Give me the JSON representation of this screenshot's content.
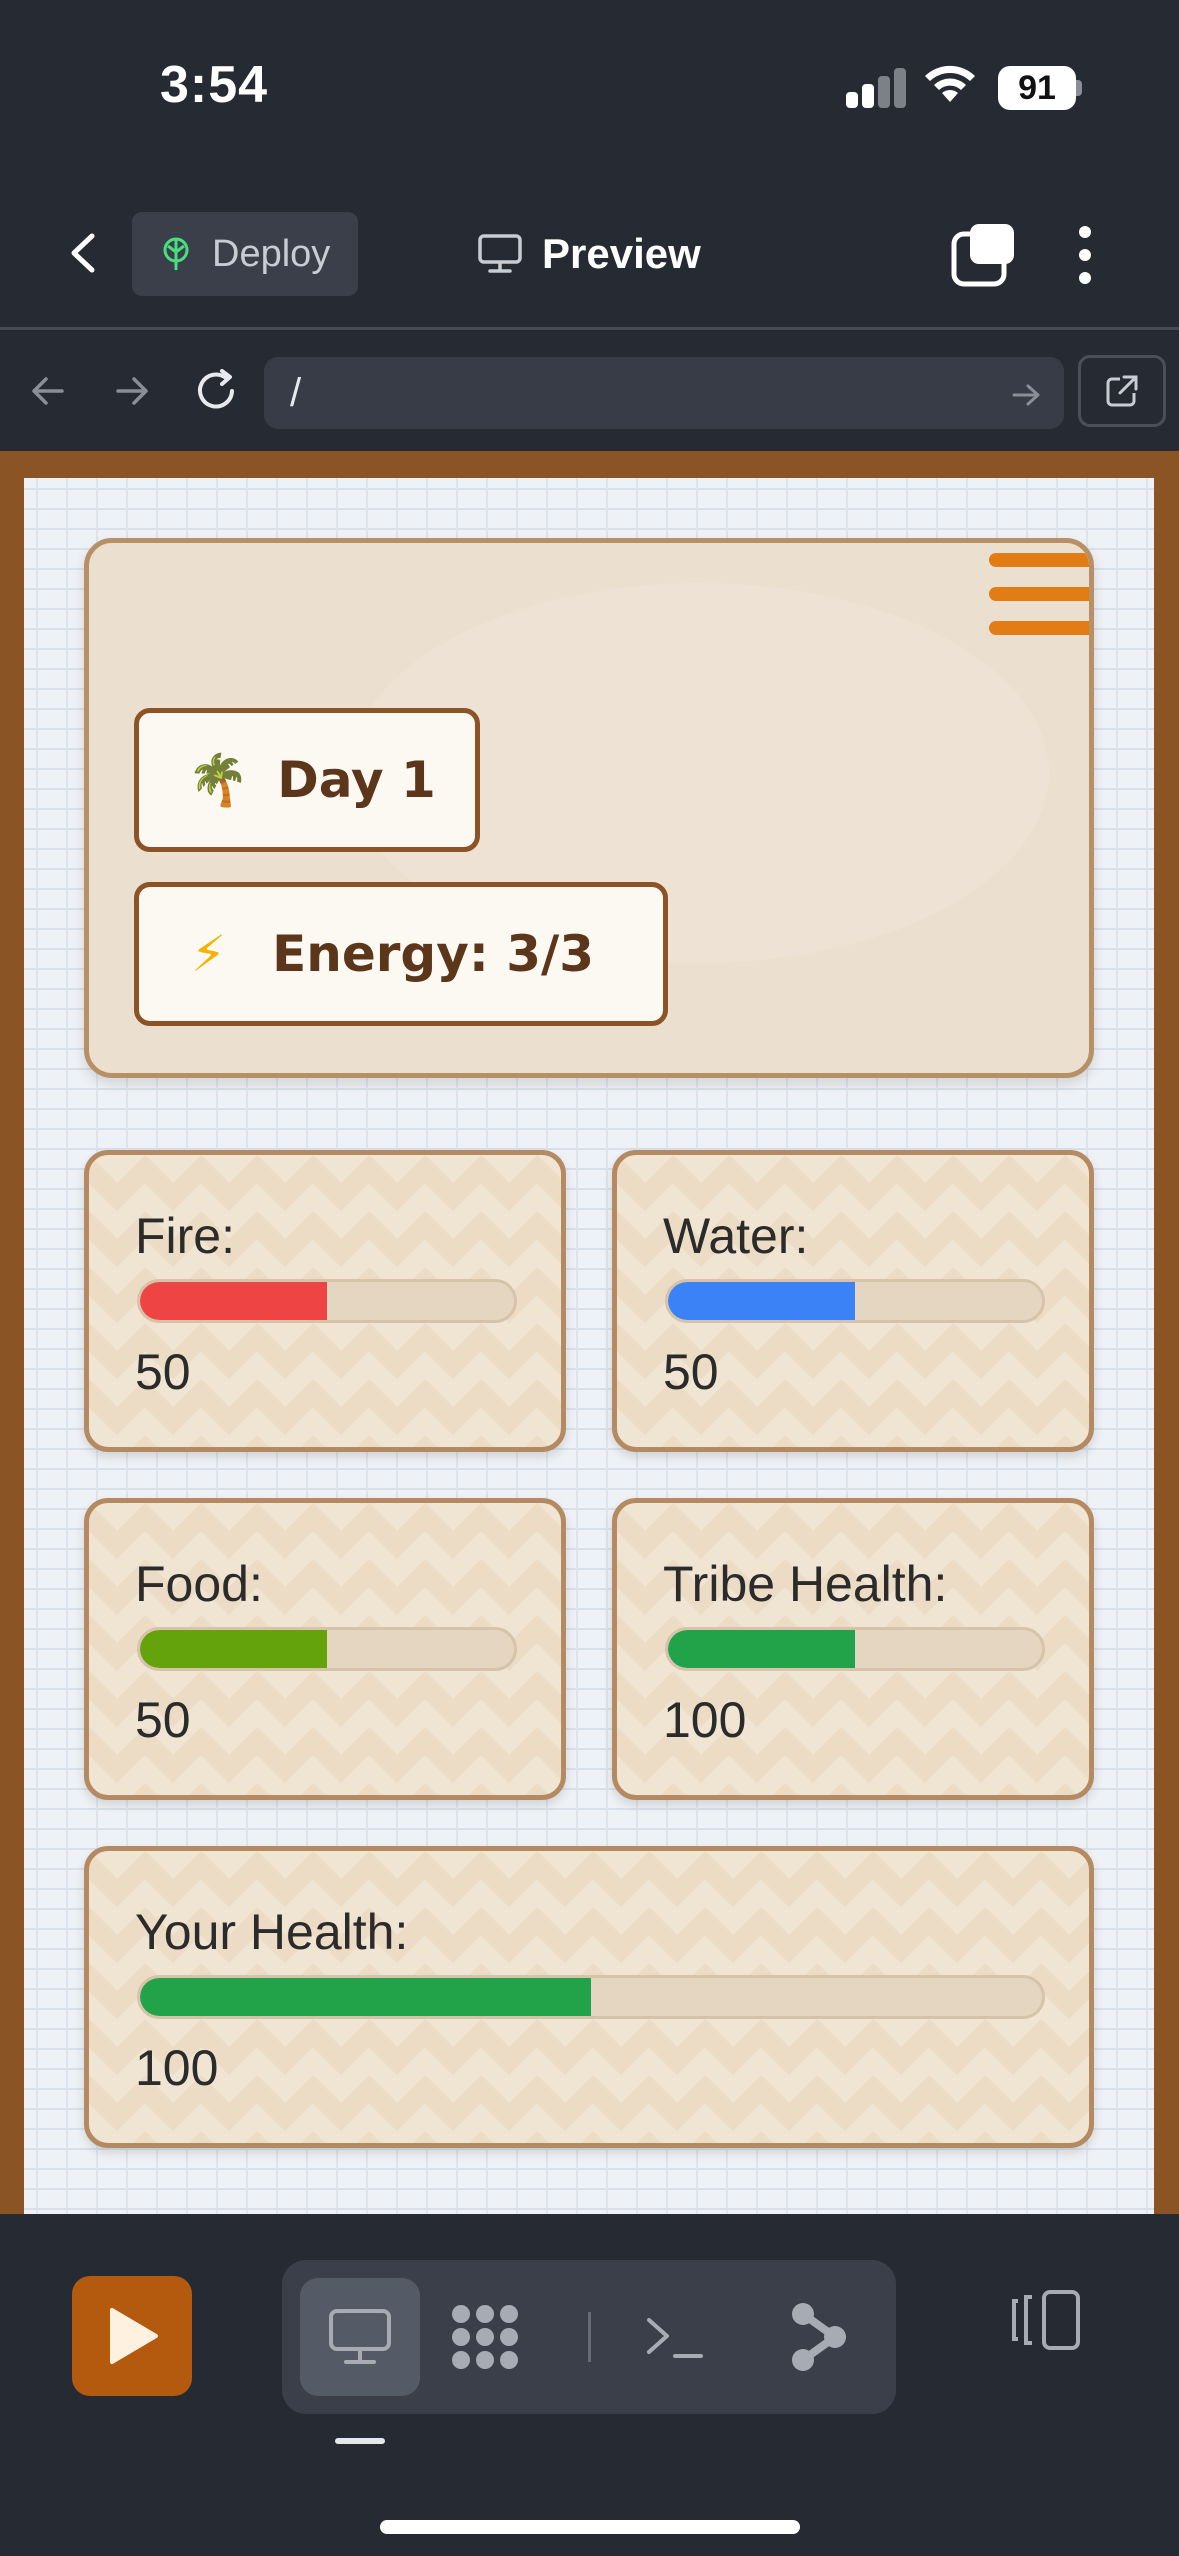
{
  "status_bar": {
    "time": "3:54",
    "battery": "91"
  },
  "app_bar": {
    "deploy_label": "Deploy",
    "preview_label": "Preview"
  },
  "url_bar": {
    "url": "/"
  },
  "game": {
    "day_icon": "🌴",
    "day_label": "Day 1",
    "energy_icon": "⚡",
    "energy_label": "Energy: 3/3",
    "accent_color": "#e17d14",
    "stats": [
      {
        "label": "Fire:",
        "value": "50",
        "fill_fraction": 0.5,
        "color": "#ef4444"
      },
      {
        "label": "Water:",
        "value": "50",
        "fill_fraction": 0.5,
        "color": "#3b82f6"
      },
      {
        "label": "Food:",
        "value": "50",
        "fill_fraction": 0.5,
        "color": "#65a30d"
      },
      {
        "label": "Tribe Health:",
        "value": "100",
        "fill_fraction": 0.5,
        "color": "#22a34a"
      },
      {
        "label": "Your Health:",
        "value": "100",
        "fill_fraction": 0.5,
        "color": "#22a34a"
      }
    ]
  },
  "toolbar": {
    "icons": [
      "play-icon",
      "desktop-icon",
      "packages-icon",
      "terminal-icon",
      "git-branch-icon",
      "panel-toggle-icon"
    ],
    "run_color": "#b35a0e"
  }
}
